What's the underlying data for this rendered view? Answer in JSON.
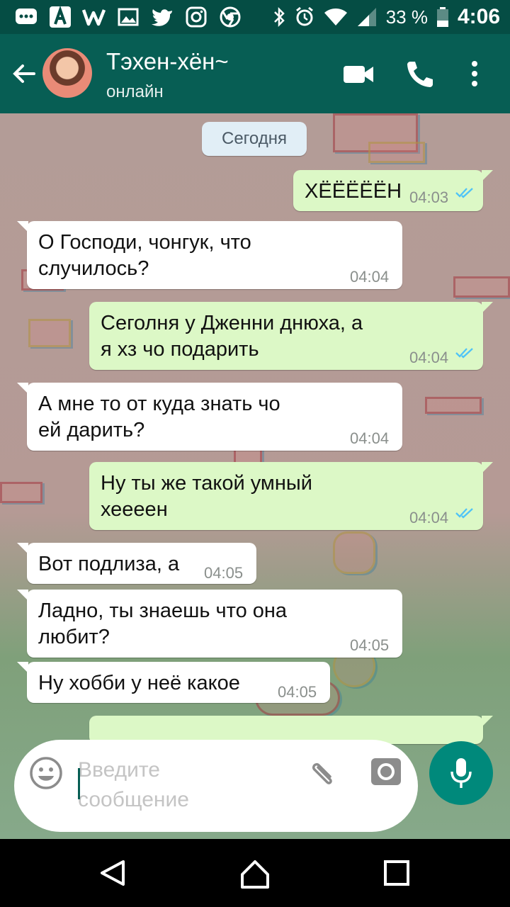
{
  "status_bar": {
    "battery": "33 %",
    "time": "4:06"
  },
  "header": {
    "contact_name": "Тэхен-хён~",
    "status": "онлайн"
  },
  "date_chip": "Сегодня",
  "messages": [
    {
      "dir": "out",
      "text": "ХЁЁЁЁЁН",
      "time": "04:03",
      "read": true
    },
    {
      "dir": "in",
      "text": "О Господи, чонгук, что\nслучилось?",
      "time": "04:04"
    },
    {
      "dir": "out",
      "text": "Сеголня у Дженни днюха, а\nя хз чо подарить",
      "time": "04:04",
      "read": true
    },
    {
      "dir": "in",
      "text": "А мне то от куда знать чо\nей дарить?",
      "time": "04:04"
    },
    {
      "dir": "out",
      "text": "Ну ты же такой умный\nхеееен",
      "time": "04:04",
      "read": true
    },
    {
      "dir": "in",
      "text": "Вот подлиза, а",
      "time": "04:05"
    },
    {
      "dir": "in",
      "text": "Ладно, ты знаешь что она\nлюбит?",
      "time": "04:05"
    },
    {
      "dir": "in",
      "text": "Ну хобби у неё какое",
      "time": "04:05"
    }
  ],
  "composer": {
    "placeholder": "Введите\nсообщение"
  },
  "colors": {
    "header": "#075e54",
    "status": "#054d44",
    "out_bubble": "#dcf8c6",
    "in_bubble": "#ffffff",
    "tick": "#4fc3f7",
    "mic": "#00897b"
  },
  "icons": [
    "back-arrow-icon",
    "video-call-icon",
    "phone-icon",
    "more-vert-icon",
    "emoji-icon",
    "attach-icon",
    "camera-icon",
    "mic-icon",
    "nav-back-icon",
    "nav-home-icon",
    "nav-recents-icon"
  ]
}
